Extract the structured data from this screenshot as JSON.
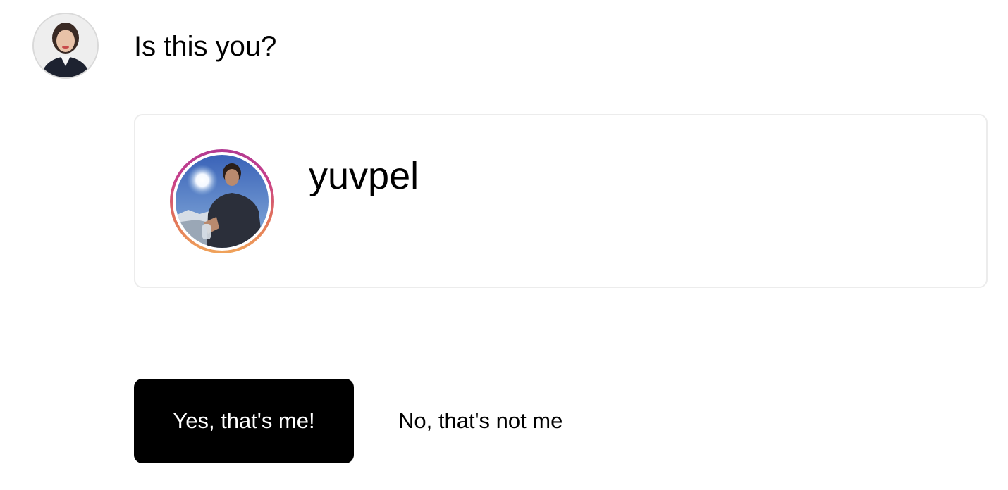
{
  "prompt": {
    "question": "Is this you?"
  },
  "profile": {
    "username": "yuvpel"
  },
  "actions": {
    "confirm_label": "Yes, that's me!",
    "deny_label": "No, that's not me"
  },
  "colors": {
    "primary_button": "#000000",
    "card_border": "#ececec",
    "ring_gradient_start": "#b23a92",
    "ring_gradient_end": "#f0a35a"
  }
}
